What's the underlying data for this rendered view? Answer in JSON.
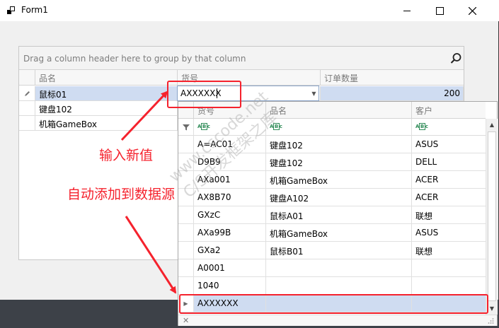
{
  "window": {
    "title": "Form1"
  },
  "grid": {
    "group_panel_text": "Drag a column header here to group by that column",
    "columns": [
      "品名",
      "货号",
      "订单数量"
    ],
    "rows": [
      {
        "name": "鼠标01",
        "code": "",
        "qty": "200"
      },
      {
        "name": "键盘102",
        "code": "",
        "qty": ""
      },
      {
        "name": "机箱GameBox",
        "code": "",
        "qty": ""
      }
    ]
  },
  "editor": {
    "value": "AXXXXXX"
  },
  "popup": {
    "columns": [
      "货号",
      "品名",
      "客户"
    ],
    "rows": [
      {
        "code": "A=AC01",
        "name": "键盘102",
        "customer": "ASUS"
      },
      {
        "code": "D9B9",
        "name": "键盘102",
        "customer": "DELL"
      },
      {
        "code": "AXa001",
        "name": "机箱GameBox",
        "customer": "ACER"
      },
      {
        "code": "AX8B70",
        "name": "键盘A102",
        "customer": "ACER"
      },
      {
        "code": "GXzC",
        "name": "鼠标A01",
        "customer": "联想"
      },
      {
        "code": "AXa99B",
        "name": "机箱GameBox",
        "customer": "ASUS"
      },
      {
        "code": "GXa2",
        "name": "鼠标B01",
        "customer": "联想"
      },
      {
        "code": "A0001",
        "name": "",
        "customer": ""
      },
      {
        "code": "1040",
        "name": "",
        "customer": ""
      }
    ],
    "new_row": {
      "code": "AXXXXXX",
      "name": "",
      "customer": ""
    }
  },
  "watermark": [
    "www.cscode.net",
    "C/S开发框架之库"
  ],
  "annotations": {
    "input_new_value": "输入新值",
    "auto_add": "自动添加到数据源"
  },
  "colors": {
    "annotation_red": "#f5222d",
    "selection_blue": "#cfdcf1"
  }
}
